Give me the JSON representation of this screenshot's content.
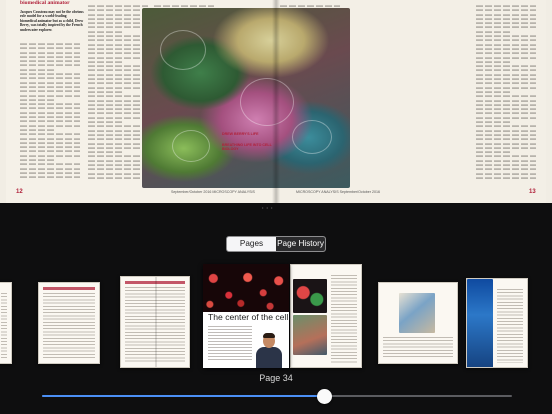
{
  "spread": {
    "left_headline": "biomedical animator",
    "left_intro": "Jacques Cousteau may not be the obvious role model for a world-leading biomedical animator but as a child, Drew Berry, was totally inspired by the French underwater explorer.",
    "left_folio": "12",
    "left_footer": "September/October 2016  MICROSCOPY ANALYSIS",
    "right_folio": "13",
    "right_footer": "MICROSCOPY ANALYSIS  September/October 2016",
    "sidebar_note_1": "DREW BERRY'S LIFE",
    "sidebar_note_2": "BREATHING LIFE INTO CELL BIOLOGY"
  },
  "view_switcher": {
    "options": [
      {
        "label": "Pages",
        "active": false
      },
      {
        "label": "Page History",
        "active": true
      }
    ]
  },
  "thumbnails": {
    "feature_title": "The center of the cell",
    "current_page_label": "Page 34"
  },
  "slider": {
    "position_fraction": 0.6,
    "track_color": "#5b5c60",
    "fill_color": "#4b8ff5",
    "thumb_color": "#fafafa"
  },
  "colors": {
    "accent_red": "#b0213a",
    "background": "#0e0e0f",
    "page_paper": "#f5f1e8"
  }
}
